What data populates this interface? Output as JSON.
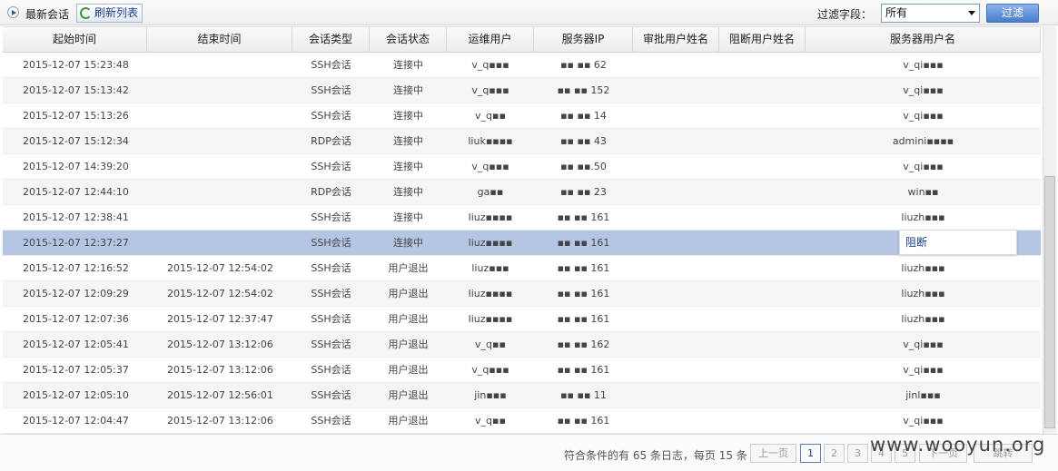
{
  "toolbar": {
    "title": "最新会话",
    "refresh_label": "刷新列表",
    "filter_label": "过滤字段：",
    "filter_selected": "所有",
    "filter_button": "过滤"
  },
  "columns": [
    "起始时间",
    "结束时间",
    "会话类型",
    "会话状态",
    "运维用户",
    "服务器IP",
    "审批用户姓名",
    "阻断用户姓名",
    "服务器用户名"
  ],
  "rows": [
    {
      "start": "2015-12-07 15:23:48",
      "end": "",
      "type": "SSH会话",
      "status": "连接中",
      "user": "v_q▪▪▪",
      "ip": "▪▪ ▪▪ 62",
      "approver": "",
      "blocker": "",
      "server_user": "v_qi▪▪▪"
    },
    {
      "start": "2015-12-07 15:13:42",
      "end": "",
      "type": "SSH会话",
      "status": "连接中",
      "user": "v_q▪▪▪",
      "ip": "▪▪ ▪▪ 152",
      "approver": "",
      "blocker": "",
      "server_user": "v_qi▪▪▪"
    },
    {
      "start": "2015-12-07 15:13:26",
      "end": "",
      "type": "SSH会话",
      "status": "连接中",
      "user": "v_q▪▪",
      "ip": "▪▪ ▪▪ 14",
      "approver": "",
      "blocker": "",
      "server_user": "v_qi▪▪▪"
    },
    {
      "start": "2015-12-07 15:12:34",
      "end": "",
      "type": "RDP会话",
      "status": "连接中",
      "user": "liuk▪▪▪▪",
      "ip": "▪▪ ▪▪ 43",
      "approver": "",
      "blocker": "",
      "server_user": "admini▪▪▪▪"
    },
    {
      "start": "2015-12-07 14:39:20",
      "end": "",
      "type": "SSH会话",
      "status": "连接中",
      "user": "v_q▪▪▪",
      "ip": "▪▪ ▪▪.50",
      "approver": "",
      "blocker": "",
      "server_user": "v_qi▪▪▪"
    },
    {
      "start": "2015-12-07 12:44:10",
      "end": "",
      "type": "RDP会话",
      "status": "连接中",
      "user": "ga▪▪",
      "ip": "▪▪ ▪▪ 23",
      "approver": "",
      "blocker": "",
      "server_user": "win▪▪"
    },
    {
      "start": "2015-12-07 12:38:41",
      "end": "",
      "type": "SSH会话",
      "status": "连接中",
      "user": "liuz▪▪▪▪",
      "ip": "▪▪ ▪▪ 161",
      "approver": "",
      "blocker": "",
      "server_user": "liuzh▪▪▪"
    },
    {
      "start": "2015-12-07 12:37:27",
      "end": "",
      "type": "SSH会话",
      "status": "连接中",
      "user": "liuz▪▪▪▪",
      "ip": "▪▪ ▪▪ 161",
      "approver": "",
      "blocker": "",
      "server_user": ""
    },
    {
      "start": "2015-12-07 12:16:52",
      "end": "2015-12-07 12:54:02",
      "type": "SSH会话",
      "status": "用户退出",
      "user": "liuz▪▪▪",
      "ip": "▪▪ ▪▪ 161",
      "approver": "",
      "blocker": "",
      "server_user": "liuzh▪▪▪"
    },
    {
      "start": "2015-12-07 12:09:29",
      "end": "2015-12-07 12:54:02",
      "type": "SSH会话",
      "status": "用户退出",
      "user": "liuz▪▪▪▪",
      "ip": "▪▪ ▪▪ 161",
      "approver": "",
      "blocker": "",
      "server_user": "liuzh▪▪▪"
    },
    {
      "start": "2015-12-07 12:07:36",
      "end": "2015-12-07 12:37:47",
      "type": "SSH会话",
      "status": "用户退出",
      "user": "liuz▪▪▪▪",
      "ip": "▪▪ ▪▪ 161",
      "approver": "",
      "blocker": "",
      "server_user": "liuzh▪▪▪"
    },
    {
      "start": "2015-12-07 12:05:41",
      "end": "2015-12-07 13:12:06",
      "type": "SSH会话",
      "status": "用户退出",
      "user": "v_q▪▪",
      "ip": "▪▪ ▪▪ 162",
      "approver": "",
      "blocker": "",
      "server_user": "v_qi▪▪▪"
    },
    {
      "start": "2015-12-07 12:05:37",
      "end": "2015-12-07 13:12:06",
      "type": "SSH会话",
      "status": "用户退出",
      "user": "v_q▪▪▪",
      "ip": "▪▪ ▪▪ 161",
      "approver": "",
      "blocker": "",
      "server_user": "v_qi▪▪▪"
    },
    {
      "start": "2015-12-07 12:05:10",
      "end": "2015-12-07 12:56:01",
      "type": "SSH会话",
      "status": "用户退出",
      "user": "jin▪▪▪",
      "ip": "▪▪ ▪▪ 11",
      "approver": "",
      "blocker": "",
      "server_user": "jinl▪▪▪"
    },
    {
      "start": "2015-12-07 12:04:47",
      "end": "2015-12-07 13:12:06",
      "type": "SSH会话",
      "status": "用户退出",
      "user": "v_q▪▪",
      "ip": "▪▪ ▪▪ 161",
      "approver": "",
      "blocker": "",
      "server_user": "v_qi▪▪▪"
    }
  ],
  "popup": {
    "label": "阻断"
  },
  "pager": {
    "summary": "符合条件的有 65 条日志，每页 15 条",
    "prev": "上一页",
    "pages": [
      "1",
      "2",
      "3",
      "4",
      "5"
    ],
    "current_page": "1",
    "next": "下一页",
    "jump": "跳转"
  },
  "watermark": "www.wooyun.org"
}
